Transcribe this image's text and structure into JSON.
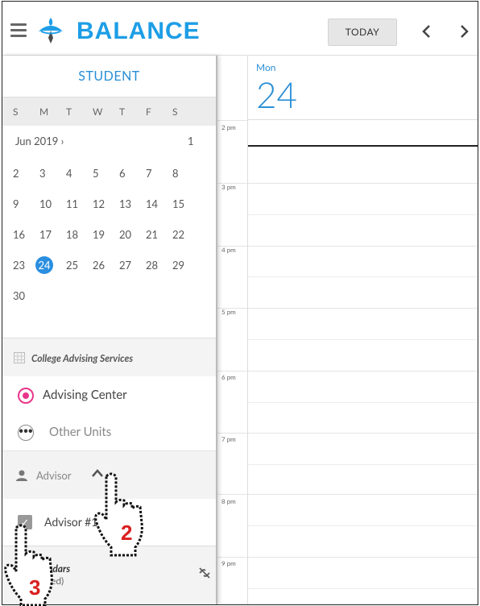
{
  "app": {
    "brand": "BALANCE"
  },
  "toolbar": {
    "today_label": "TODAY",
    "prev_icon": "chevron-left-icon",
    "next_icon": "chevron-right-icon"
  },
  "sidebar": {
    "student_label": "STUDENT",
    "weekday_headers": [
      "S",
      "M",
      "T",
      "W",
      "T",
      "F",
      "S"
    ],
    "month_label": "Jun 2019 ›",
    "first_day": "1",
    "weeks": [
      [
        "2",
        "3",
        "4",
        "5",
        "6",
        "7",
        "8"
      ],
      [
        "9",
        "10",
        "11",
        "12",
        "13",
        "14",
        "15"
      ],
      [
        "16",
        "17",
        "18",
        "19",
        "20",
        "21",
        "22"
      ],
      [
        "23",
        "24",
        "25",
        "26",
        "27",
        "28",
        "29"
      ],
      [
        "30",
        "",
        "",
        "",
        "",
        "",
        ""
      ]
    ],
    "selected_day": "24",
    "services_label": "College Advising Services",
    "units": [
      {
        "label": "Advising Center",
        "selected": true
      },
      {
        "label": "Other Units",
        "selected": false
      }
    ],
    "advisor_label": "Advisor",
    "advisor_item": "Advisor #1",
    "calendars_title": "endars",
    "calendars_sub": "cted)"
  },
  "day_view": {
    "weekday": "Mon",
    "date": "24",
    "hours": [
      "2 pm",
      "3 pm",
      "4 pm",
      "5 pm",
      "6 pm",
      "7 pm",
      "8 pm",
      "9 pm"
    ]
  },
  "annotations": {
    "step_2": "2",
    "step_3": "3"
  },
  "colors": {
    "brand": "#1d9ee6",
    "accent": "#2a8fd6",
    "radio": "#e8368a",
    "annotation": "#d9201f"
  }
}
